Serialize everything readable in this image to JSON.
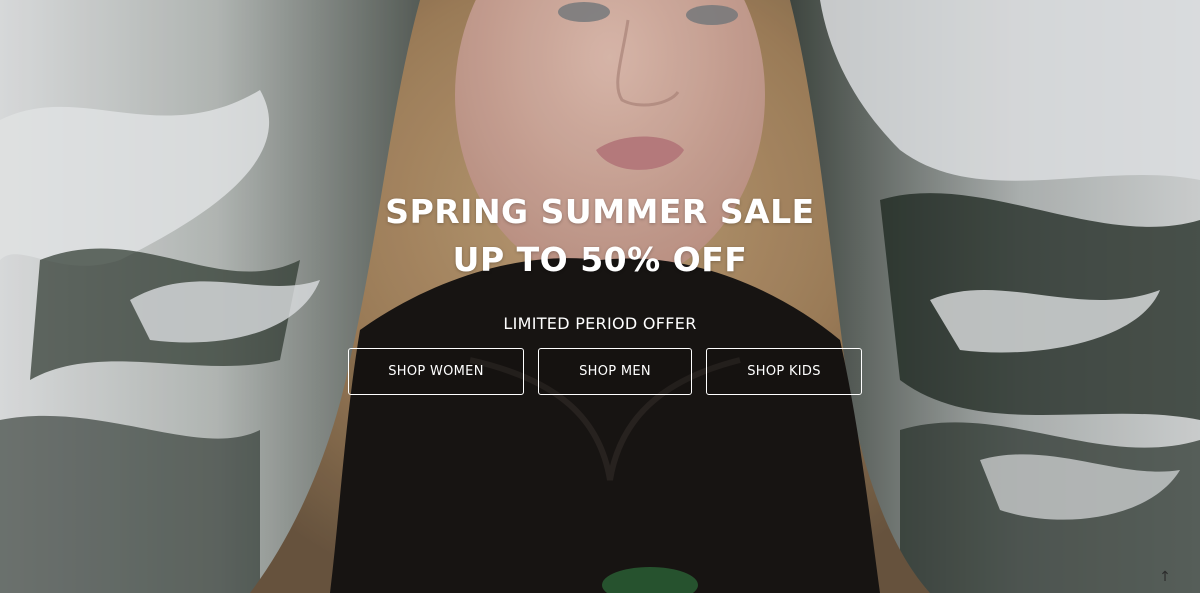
{
  "hero": {
    "headline_line1": "SPRING SUMMER SALE",
    "headline_line2": "UP TO 50% OFF",
    "subline": "LIMITED PERIOD OFFER",
    "buttons": [
      {
        "label": "SHOP WOMEN"
      },
      {
        "label": "SHOP MEN"
      },
      {
        "label": "SHOP KIDS"
      }
    ]
  },
  "icons": {
    "scroll_top": "arrow-up-icon"
  },
  "colors": {
    "text": "#ffffff",
    "button_border": "#ffffff"
  }
}
